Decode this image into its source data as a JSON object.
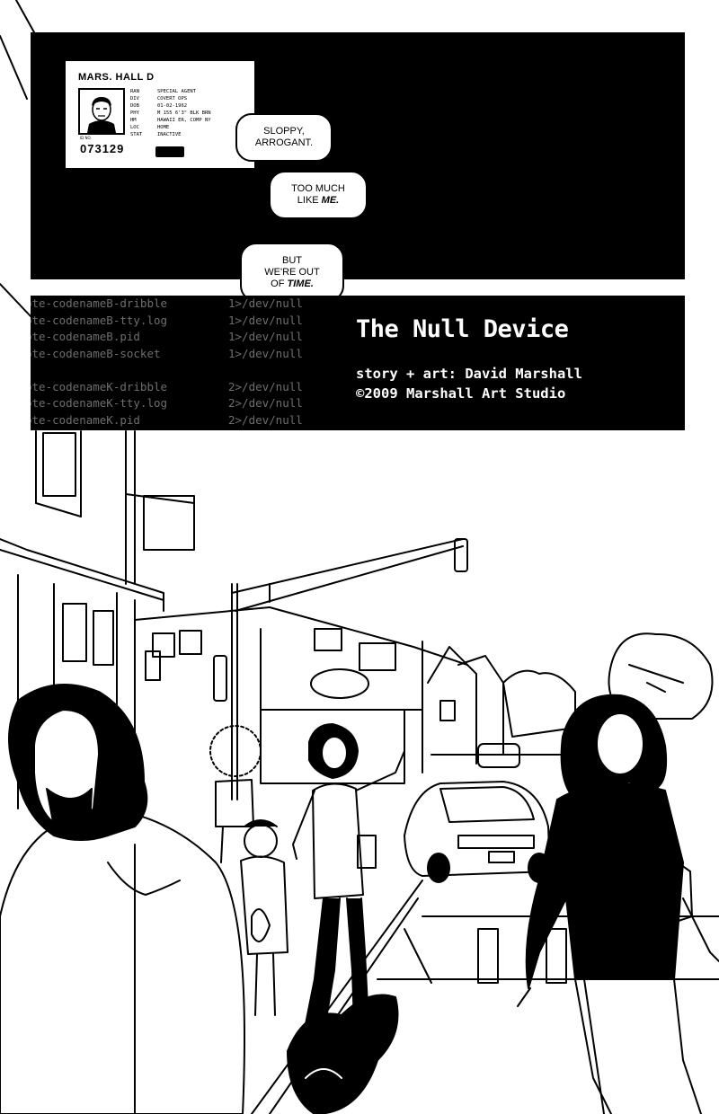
{
  "id_card": {
    "name": "MARS. HALL D",
    "fields": [
      {
        "key": "RAN",
        "value": "SPECIAL AGENT"
      },
      {
        "key": "DIV",
        "value": "COVERT OPS"
      },
      {
        "key": "DOB",
        "value": "01-02-1962"
      },
      {
        "key": "PHY",
        "value": "M 155 6'3\" BLK BRN"
      },
      {
        "key": "HM",
        "value": "HAWAII ER, COMP NY"
      },
      {
        "key": "LOC",
        "value": "HOME"
      },
      {
        "key": "STAT",
        "value": "INACTIVE"
      }
    ],
    "number_label": "ID NO.",
    "number": "073129"
  },
  "bubbles": [
    {
      "lines": [
        "SLOPPY,",
        "ARROGANT."
      ]
    },
    {
      "lines": [
        "TOO MUCH",
        "LIKE ",
        "ME."
      ]
    },
    {
      "lines": [
        "BUT",
        "WE'RE OUT",
        "OF ",
        "TIME."
      ]
    }
  ],
  "terminal": [
    {
      "file": "ote-codenameB-dribble",
      "redirect": "1>/dev/null"
    },
    {
      "file": "ote-codenameB-tty.log",
      "redirect": "1>/dev/null"
    },
    {
      "file": "ote-codenameB.pid",
      "redirect": "1>/dev/null"
    },
    {
      "file": "ote-codenameB-socket",
      "redirect": "1>/dev/null"
    },
    {
      "file": "",
      "redirect": ""
    },
    {
      "file": "ote-codenameK-dribble",
      "redirect": "2>/dev/null"
    },
    {
      "file": "ote-codenameK-tty.log",
      "redirect": "2>/dev/null"
    },
    {
      "file": "ote-codenameK.pid",
      "redirect": "2>/dev/null"
    }
  ],
  "title": "The Null Device",
  "credit_line_1": "story + art: David Marshall",
  "credit_line_2": "©2009 Marshall Art Studio",
  "colors": {
    "ink": "#000000",
    "paper": "#ffffff",
    "terminal_text": "#6e6e6e"
  }
}
